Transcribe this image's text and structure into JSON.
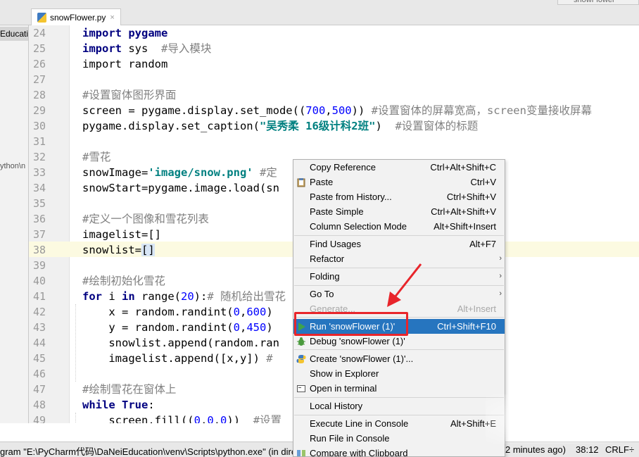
{
  "tabbar": {
    "tab_label": "snowFlower.py",
    "close_glyph": "×",
    "top_right_tab": "snowFlower"
  },
  "project": {
    "item1": "Educatio",
    "item2": "ython\\n"
  },
  "editor": {
    "lines": [
      {
        "n": "24"
      },
      {
        "n": "25"
      },
      {
        "n": "26"
      },
      {
        "n": "27"
      },
      {
        "n": "28"
      },
      {
        "n": "29"
      },
      {
        "n": "30"
      },
      {
        "n": "31"
      },
      {
        "n": "32"
      },
      {
        "n": "33"
      },
      {
        "n": "34"
      },
      {
        "n": "35"
      },
      {
        "n": "36"
      },
      {
        "n": "37"
      },
      {
        "n": "38"
      },
      {
        "n": "39"
      },
      {
        "n": "40"
      },
      {
        "n": "41"
      },
      {
        "n": "42"
      },
      {
        "n": "43"
      },
      {
        "n": "44"
      },
      {
        "n": "45"
      },
      {
        "n": "46"
      },
      {
        "n": "47"
      },
      {
        "n": "48"
      },
      {
        "n": "49"
      }
    ],
    "code": {
      "l24": "import pygame",
      "l25": "import sys  #导入模块",
      "l26": "import random",
      "l28": "#设置窗体图形界面",
      "l29a": "screen = pygame.display.set_mode((",
      "l29b": "700",
      "l29c": ",",
      "l29d": "500",
      "l29e": ")) ",
      "l29f": "#设置窗体的屏幕宽高，screen变量接收屏幕",
      "l30a": "pygame.display.set_caption(",
      "l30b": "\"吴秀柔 16级计科2班\"",
      "l30c": ")  ",
      "l30d": "#设置窗体的标题",
      "l32": "#雪花",
      "l33a": "snowImage=",
      "l33b": "'image/snow.png'",
      "l33c": " #定",
      "l34": "snowStart=pygame.image.load(sn",
      "l36": "#定义一个图像和雪花列表",
      "l37": "imagelist=[]",
      "l38a": "snowlist=",
      "l38b": "[]",
      "l40": "#绘制初始化雪花",
      "l41a": "for",
      "l41b": " i ",
      "l41c": "in",
      "l41d": " range(",
      "l41e": "20",
      "l41f": "):",
      "l41g": "# 随机给出雪花",
      "l42a": "    x = random.randint(",
      "l42b": "0",
      "l42c": ",",
      "l42d": "600",
      "l42e": ")",
      "l43a": "    y = random.randint(",
      "l43b": "0",
      "l43c": ",",
      "l43d": "450",
      "l43e": ")",
      "l44": "    snowlist.append(random.ran",
      "l45a": "    imagelist.append([x,y]) ",
      "l45b": "#",
      "l47": "#绘制雪花在窗体上",
      "l48a": "while",
      "l48b": " ",
      "l48c": "True",
      "l48d": ":",
      "l49a": "    screen.fill((",
      "l49b": "0",
      "l49c": ",",
      "l49d": "0",
      "l49e": ",",
      "l49f": "0",
      "l49g": "))  ",
      "l49h": "#设置"
    }
  },
  "menu": {
    "items": [
      {
        "label": "Copy Reference",
        "shortcut": "Ctrl+Alt+Shift+C"
      },
      {
        "label": "Paste",
        "shortcut": "Ctrl+V"
      },
      {
        "label": "Paste from History...",
        "shortcut": "Ctrl+Shift+V"
      },
      {
        "label": "Paste Simple",
        "shortcut": "Ctrl+Alt+Shift+V"
      },
      {
        "label": "Column Selection Mode",
        "shortcut": "Alt+Shift+Insert"
      },
      {
        "label": "Find Usages",
        "shortcut": "Alt+F7"
      },
      {
        "label": "Refactor",
        "shortcut": ""
      },
      {
        "label": "Folding",
        "shortcut": ""
      },
      {
        "label": "Go To",
        "shortcut": ""
      },
      {
        "label": "Generate...",
        "shortcut": "Alt+Insert"
      },
      {
        "label": "Run 'snowFlower (1)'",
        "shortcut": "Ctrl+Shift+F10"
      },
      {
        "label": "Debug 'snowFlower (1)'",
        "shortcut": ""
      },
      {
        "label": "Create 'snowFlower (1)'...",
        "shortcut": ""
      },
      {
        "label": "Show in Explorer",
        "shortcut": ""
      },
      {
        "label": "Open in terminal",
        "shortcut": ""
      },
      {
        "label": "Local History",
        "shortcut": ""
      },
      {
        "label": "Execute Line in Console",
        "shortcut": "Alt+Shift+E"
      },
      {
        "label": "Run File in Console",
        "shortcut": ""
      },
      {
        "label": "Compare with Clipboard",
        "shortcut": ""
      }
    ],
    "submenu_arrow": "›",
    "highlight_color": "#2675bf"
  },
  "status": {
    "left": "gram \"E:\\PyCharm代码\\DaNeiEducation\\venv\\Scripts\\python.exe\" (in dire",
    "time": "2 minutes ago)",
    "position": "38:12",
    "line_sep": "CRLF÷"
  },
  "annotation": {
    "highlight_color": "#e8252b"
  }
}
